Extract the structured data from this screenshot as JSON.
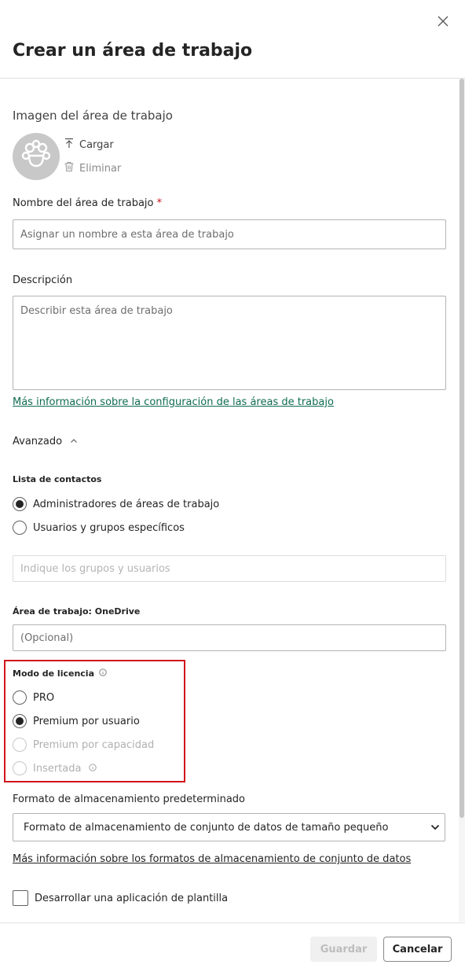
{
  "panel": {
    "title": "Crear un área de trabajo",
    "close_icon": "close-icon"
  },
  "image_section": {
    "label": "Imagen del área de trabajo",
    "avatar_icon": "placeholder-face-icon",
    "upload_label": "Cargar",
    "upload_icon": "upload-icon",
    "delete_label": "Eliminar",
    "delete_icon": "trash-icon"
  },
  "name_field": {
    "label": "Nombre del área de trabajo",
    "required_marker": "*",
    "value": "",
    "placeholder": "Asignar un nombre a esta área de trabajo"
  },
  "description_field": {
    "label": "Descripción",
    "value": "",
    "placeholder": "Describir esta área de trabajo"
  },
  "settings_link": "Más información sobre la configuración de las áreas de trabajo",
  "advanced": {
    "label": "Avanzado",
    "expanded": true,
    "chevron_icon": "chevron-up-icon"
  },
  "contacts": {
    "label": "Lista de contactos",
    "options": [
      {
        "label": "Administradores de áreas de trabajo",
        "selected": true,
        "disabled": false
      },
      {
        "label": "Usuarios y grupos específicos",
        "selected": false,
        "disabled": false
      }
    ],
    "users_placeholder": "Indique los grupos y usuarios"
  },
  "onedrive": {
    "label": "Área de trabajo: OneDrive",
    "placeholder": "(Opcional)"
  },
  "license": {
    "label": "Modo de licencia",
    "info_icon": "info-icon",
    "options": [
      {
        "label": "PRO",
        "selected": false,
        "disabled": false
      },
      {
        "label": "Premium por usuario",
        "selected": true,
        "disabled": false
      },
      {
        "label": "Premium por capacidad",
        "selected": false,
        "disabled": true
      },
      {
        "label": "Insertada",
        "selected": false,
        "disabled": true
      }
    ],
    "highlight_color": "#d1141b"
  },
  "storage": {
    "label": "Formato de almacenamiento predeterminado",
    "selected": "Formato de almacenamiento de conjunto de datos de tamaño pequeño",
    "chevron_icon": "chevron-down-icon",
    "link": "Más información sobre los formatos de almacenamiento de conjunto de datos"
  },
  "template_app": {
    "label": "Desarrollar una aplicación de plantilla",
    "checked": false
  },
  "footer": {
    "save_label": "Guardar",
    "cancel_label": "Cancelar"
  },
  "colors": {
    "link": "#0f6b52",
    "required": "#c50f1f"
  }
}
